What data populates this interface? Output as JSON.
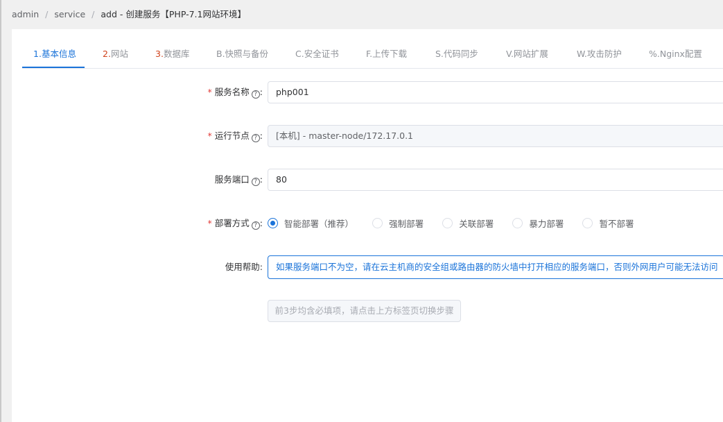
{
  "breadcrumb": [
    "admin",
    "service",
    "add  -  创建服务【PHP-7.1网站环境】"
  ],
  "tabs": [
    {
      "num": "1.",
      "text": "基本信息",
      "active": true
    },
    {
      "num": "2.",
      "text": "网站"
    },
    {
      "num": "3.",
      "text": "数据库"
    },
    {
      "num": "",
      "text": "B.快照与备份"
    },
    {
      "num": "",
      "text": "C.安全证书"
    },
    {
      "num": "",
      "text": "F.上传下载"
    },
    {
      "num": "",
      "text": "S.代码同步"
    },
    {
      "num": "",
      "text": "V.网站扩展"
    },
    {
      "num": "",
      "text": "W.攻击防护"
    },
    {
      "num": "",
      "text": "%.Nginx配置"
    }
  ],
  "form": {
    "service_name": {
      "label": "服务名称",
      "required": "*",
      "value": "php001"
    },
    "run_node": {
      "label": "运行节点",
      "required": "*",
      "value": "[本机] - master-node/172.17.0.1"
    },
    "service_port": {
      "label": "服务端口",
      "value": "80"
    },
    "deploy_mode": {
      "label": "部署方式",
      "required": "*",
      "options": [
        "智能部署（推荐）",
        "强制部署",
        "关联部署",
        "暴力部署",
        "暂不部署"
      ],
      "selected": "智能部署（推荐）"
    },
    "help": {
      "label": "使用帮助:",
      "text": "如果服务端口不为空，请在云主机商的安全组或路由器的防火墙中打开相应的服务端口，否则外网用户可能无法访问"
    },
    "label_suffix": ":",
    "submit_label": "前3步均含必填项，请点击上方标签页切换步骤"
  },
  "colors": {
    "accent": "#1a73d9",
    "required": "#e23c39",
    "tab_number": "#d0421b"
  },
  "icons": {
    "help": "question-circle-icon",
    "radio": "radio-circle-icon"
  }
}
